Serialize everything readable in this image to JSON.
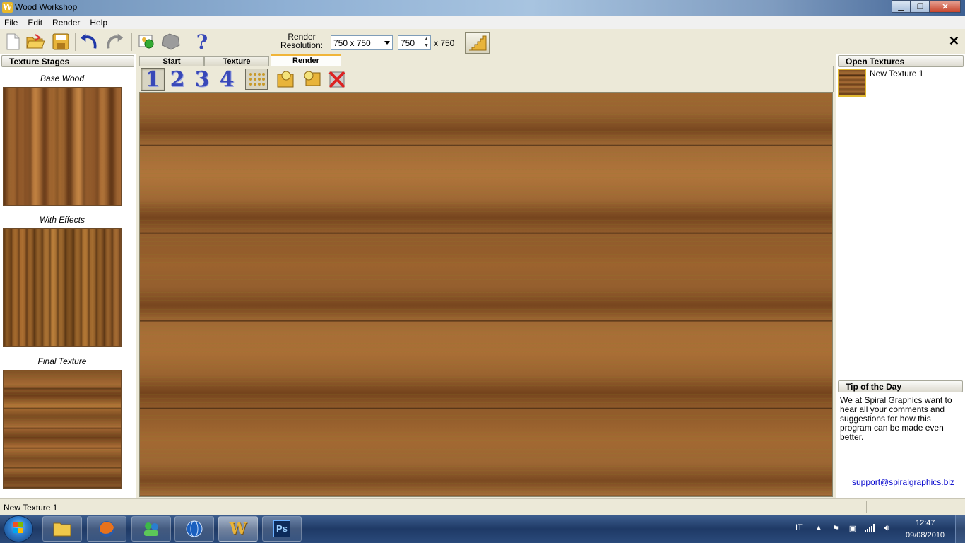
{
  "window": {
    "title": "Wood Workshop",
    "app_icon_letter": "W"
  },
  "menu": [
    "File",
    "Edit",
    "Render",
    "Help"
  ],
  "toolbar": {
    "resolution_label": "Render Resolution:",
    "resolution_value": "750 x 750",
    "width_value": "750",
    "height_text": "x 750",
    "close_glyph": "✕"
  },
  "left_panel": {
    "header": "Texture Stages",
    "stages": [
      "Base Wood",
      "With Effects",
      "Final Texture"
    ]
  },
  "tabs": [
    "Start",
    "Texture",
    "Render"
  ],
  "render_toolbar": {
    "views": [
      "1",
      "2",
      "3",
      "4"
    ]
  },
  "right_panel": {
    "open_header": "Open Textures",
    "open_items": [
      "New Texture 1"
    ],
    "tip_header": "Tip of the Day",
    "tip_text": "We at Spiral Graphics want to hear all your comments and suggestions for how this program can be made even better.",
    "tip_link": "support@spiralgraphics.biz"
  },
  "status": {
    "text": "New Texture 1"
  },
  "taskbar": {
    "language": "IT",
    "time": "12:47",
    "date": "09/08/2010",
    "ps_label": "Ps",
    "ww_label": "W"
  },
  "colors": {
    "accent": "#f0b53a",
    "view_number": "#3848b8",
    "link": "#0000cc"
  }
}
